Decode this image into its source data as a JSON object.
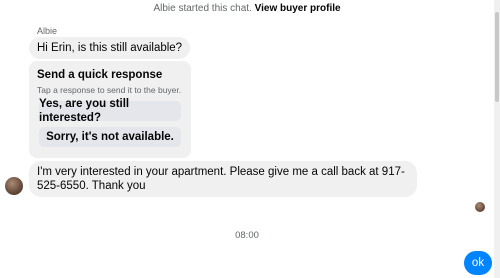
{
  "chat": {
    "system_text": "Albie started this chat.",
    "system_link": "View buyer profile",
    "sender_name": "Albie",
    "first_message": "Hi Erin, is this still available?",
    "quick_response": {
      "title": "Send a quick response",
      "subtitle": "Tap a response to send it to the buyer.",
      "options": [
        "Yes, are you still interested?",
        "Sorry, it's not available."
      ]
    },
    "second_message": "I'm very interested in your apartment. Please give me a call back at 917-525-6550. Thank you",
    "timestamp": "08:00",
    "my_message": "ok"
  },
  "colors": {
    "incoming_bubble": "#f0f0f0",
    "outgoing_bubble": "#0084ff",
    "secondary_text": "#65676b"
  },
  "icons": {
    "sender_avatar": "avatar",
    "seen_indicator": "seen-avatar-icon"
  }
}
